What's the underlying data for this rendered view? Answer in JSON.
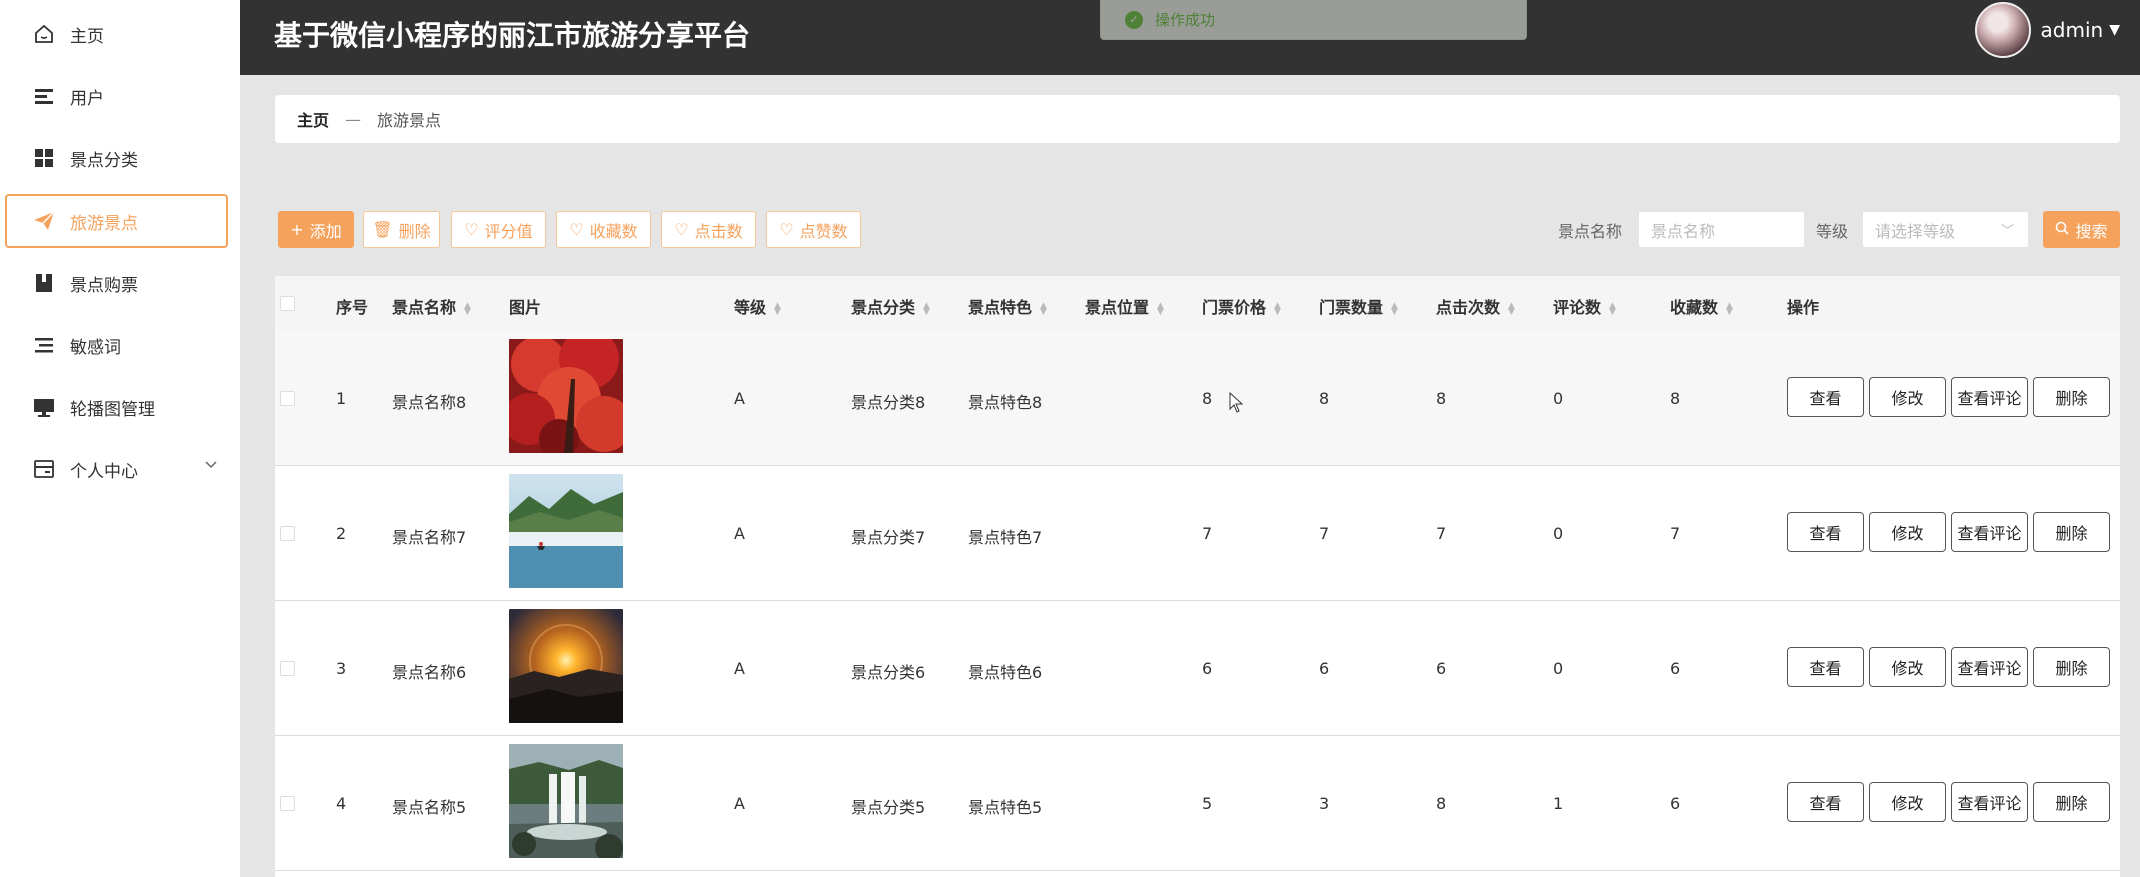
{
  "sidebar": {
    "items": [
      {
        "label": "主页",
        "icon": "home-icon"
      },
      {
        "label": "用户",
        "icon": "user-list-icon"
      },
      {
        "label": "景点分类",
        "icon": "grid-icon"
      },
      {
        "label": "旅游景点",
        "icon": "paper-plane-icon"
      },
      {
        "label": "景点购票",
        "icon": "ticket-book-icon"
      },
      {
        "label": "敏感词",
        "icon": "list-icon"
      },
      {
        "label": "轮播图管理",
        "icon": "monitor-icon"
      },
      {
        "label": "个人中心",
        "icon": "card-icon"
      }
    ]
  },
  "header": {
    "title": "基于微信小程序的丽江市旅游分享平台",
    "username": "admin"
  },
  "toast": {
    "message": "操作成功"
  },
  "breadcrumb": {
    "home": "主页",
    "separator": "—",
    "current": "旅游景点"
  },
  "toolbar": {
    "add": "添加",
    "delete": "删除",
    "rating": "评分值",
    "favorites": "收藏数",
    "clicks": "点击数",
    "likes": "点赞数"
  },
  "search": {
    "name_label": "景点名称",
    "name_placeholder": "景点名称",
    "level_label": "等级",
    "level_placeholder": "请选择等级",
    "button": "搜索"
  },
  "table": {
    "columns": [
      "序号",
      "景点名称",
      "图片",
      "等级",
      "景点分类",
      "景点特色",
      "景点位置",
      "门票价格",
      "门票数量",
      "点击次数",
      "评论数",
      "收藏数",
      "操作"
    ],
    "actions": {
      "view": "查看",
      "edit": "修改",
      "comments": "查看评论",
      "delete": "删除"
    },
    "rows": [
      {
        "index": "1",
        "name": "景点名称8",
        "level": "A",
        "category": "景点分类8",
        "feature": "景点特色8",
        "location": "",
        "price": "8",
        "quantity": "8",
        "clicks": "8",
        "comments": "0",
        "favorites": "8"
      },
      {
        "index": "2",
        "name": "景点名称7",
        "level": "A",
        "category": "景点分类7",
        "feature": "景点特色7",
        "location": "",
        "price": "7",
        "quantity": "7",
        "clicks": "7",
        "comments": "0",
        "favorites": "7"
      },
      {
        "index": "3",
        "name": "景点名称6",
        "level": "A",
        "category": "景点分类6",
        "feature": "景点特色6",
        "location": "",
        "price": "6",
        "quantity": "6",
        "clicks": "6",
        "comments": "0",
        "favorites": "6"
      },
      {
        "index": "4",
        "name": "景点名称5",
        "level": "A",
        "category": "景点分类5",
        "feature": "景点特色5",
        "location": "",
        "price": "5",
        "quantity": "3",
        "clicks": "8",
        "comments": "1",
        "favorites": "6"
      }
    ]
  },
  "colors": {
    "accent": "#f5a25d",
    "header_bg": "#323232",
    "success": "#67c23a"
  }
}
